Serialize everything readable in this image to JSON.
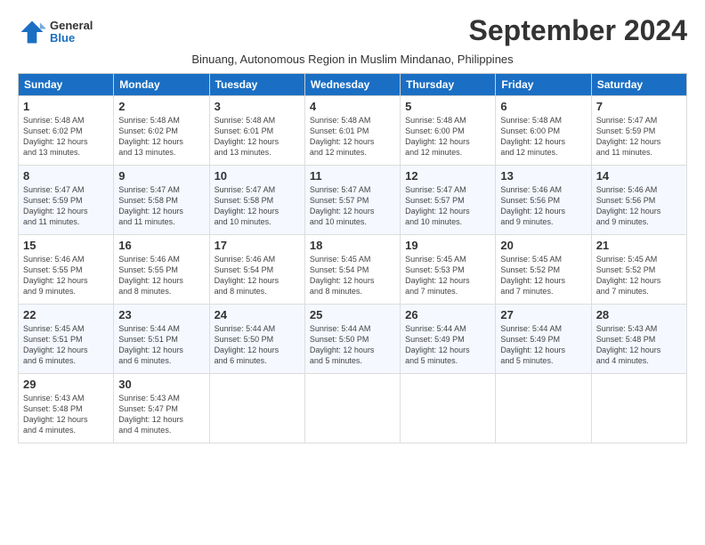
{
  "header": {
    "logo_general": "General",
    "logo_blue": "Blue",
    "month": "September 2024",
    "subtitle": "Binuang, Autonomous Region in Muslim Mindanao, Philippines"
  },
  "weekdays": [
    "Sunday",
    "Monday",
    "Tuesday",
    "Wednesday",
    "Thursday",
    "Friday",
    "Saturday"
  ],
  "weeks": [
    [
      {
        "day": "1",
        "lines": [
          "Sunrise: 5:48 AM",
          "Sunset: 6:02 PM",
          "Daylight: 12 hours",
          "and 13 minutes."
        ]
      },
      {
        "day": "2",
        "lines": [
          "Sunrise: 5:48 AM",
          "Sunset: 6:02 PM",
          "Daylight: 12 hours",
          "and 13 minutes."
        ]
      },
      {
        "day": "3",
        "lines": [
          "Sunrise: 5:48 AM",
          "Sunset: 6:01 PM",
          "Daylight: 12 hours",
          "and 13 minutes."
        ]
      },
      {
        "day": "4",
        "lines": [
          "Sunrise: 5:48 AM",
          "Sunset: 6:01 PM",
          "Daylight: 12 hours",
          "and 12 minutes."
        ]
      },
      {
        "day": "5",
        "lines": [
          "Sunrise: 5:48 AM",
          "Sunset: 6:00 PM",
          "Daylight: 12 hours",
          "and 12 minutes."
        ]
      },
      {
        "day": "6",
        "lines": [
          "Sunrise: 5:48 AM",
          "Sunset: 6:00 PM",
          "Daylight: 12 hours",
          "and 12 minutes."
        ]
      },
      {
        "day": "7",
        "lines": [
          "Sunrise: 5:47 AM",
          "Sunset: 5:59 PM",
          "Daylight: 12 hours",
          "and 11 minutes."
        ]
      }
    ],
    [
      {
        "day": "8",
        "lines": [
          "Sunrise: 5:47 AM",
          "Sunset: 5:59 PM",
          "Daylight: 12 hours",
          "and 11 minutes."
        ]
      },
      {
        "day": "9",
        "lines": [
          "Sunrise: 5:47 AM",
          "Sunset: 5:58 PM",
          "Daylight: 12 hours",
          "and 11 minutes."
        ]
      },
      {
        "day": "10",
        "lines": [
          "Sunrise: 5:47 AM",
          "Sunset: 5:58 PM",
          "Daylight: 12 hours",
          "and 10 minutes."
        ]
      },
      {
        "day": "11",
        "lines": [
          "Sunrise: 5:47 AM",
          "Sunset: 5:57 PM",
          "Daylight: 12 hours",
          "and 10 minutes."
        ]
      },
      {
        "day": "12",
        "lines": [
          "Sunrise: 5:47 AM",
          "Sunset: 5:57 PM",
          "Daylight: 12 hours",
          "and 10 minutes."
        ]
      },
      {
        "day": "13",
        "lines": [
          "Sunrise: 5:46 AM",
          "Sunset: 5:56 PM",
          "Daylight: 12 hours",
          "and 9 minutes."
        ]
      },
      {
        "day": "14",
        "lines": [
          "Sunrise: 5:46 AM",
          "Sunset: 5:56 PM",
          "Daylight: 12 hours",
          "and 9 minutes."
        ]
      }
    ],
    [
      {
        "day": "15",
        "lines": [
          "Sunrise: 5:46 AM",
          "Sunset: 5:55 PM",
          "Daylight: 12 hours",
          "and 9 minutes."
        ]
      },
      {
        "day": "16",
        "lines": [
          "Sunrise: 5:46 AM",
          "Sunset: 5:55 PM",
          "Daylight: 12 hours",
          "and 8 minutes."
        ]
      },
      {
        "day": "17",
        "lines": [
          "Sunrise: 5:46 AM",
          "Sunset: 5:54 PM",
          "Daylight: 12 hours",
          "and 8 minutes."
        ]
      },
      {
        "day": "18",
        "lines": [
          "Sunrise: 5:45 AM",
          "Sunset: 5:54 PM",
          "Daylight: 12 hours",
          "and 8 minutes."
        ]
      },
      {
        "day": "19",
        "lines": [
          "Sunrise: 5:45 AM",
          "Sunset: 5:53 PM",
          "Daylight: 12 hours",
          "and 7 minutes."
        ]
      },
      {
        "day": "20",
        "lines": [
          "Sunrise: 5:45 AM",
          "Sunset: 5:52 PM",
          "Daylight: 12 hours",
          "and 7 minutes."
        ]
      },
      {
        "day": "21",
        "lines": [
          "Sunrise: 5:45 AM",
          "Sunset: 5:52 PM",
          "Daylight: 12 hours",
          "and 7 minutes."
        ]
      }
    ],
    [
      {
        "day": "22",
        "lines": [
          "Sunrise: 5:45 AM",
          "Sunset: 5:51 PM",
          "Daylight: 12 hours",
          "and 6 minutes."
        ]
      },
      {
        "day": "23",
        "lines": [
          "Sunrise: 5:44 AM",
          "Sunset: 5:51 PM",
          "Daylight: 12 hours",
          "and 6 minutes."
        ]
      },
      {
        "day": "24",
        "lines": [
          "Sunrise: 5:44 AM",
          "Sunset: 5:50 PM",
          "Daylight: 12 hours",
          "and 6 minutes."
        ]
      },
      {
        "day": "25",
        "lines": [
          "Sunrise: 5:44 AM",
          "Sunset: 5:50 PM",
          "Daylight: 12 hours",
          "and 5 minutes."
        ]
      },
      {
        "day": "26",
        "lines": [
          "Sunrise: 5:44 AM",
          "Sunset: 5:49 PM",
          "Daylight: 12 hours",
          "and 5 minutes."
        ]
      },
      {
        "day": "27",
        "lines": [
          "Sunrise: 5:44 AM",
          "Sunset: 5:49 PM",
          "Daylight: 12 hours",
          "and 5 minutes."
        ]
      },
      {
        "day": "28",
        "lines": [
          "Sunrise: 5:43 AM",
          "Sunset: 5:48 PM",
          "Daylight: 12 hours",
          "and 4 minutes."
        ]
      }
    ],
    [
      {
        "day": "29",
        "lines": [
          "Sunrise: 5:43 AM",
          "Sunset: 5:48 PM",
          "Daylight: 12 hours",
          "and 4 minutes."
        ]
      },
      {
        "day": "30",
        "lines": [
          "Sunrise: 5:43 AM",
          "Sunset: 5:47 PM",
          "Daylight: 12 hours",
          "and 4 minutes."
        ]
      },
      {
        "day": "",
        "lines": []
      },
      {
        "day": "",
        "lines": []
      },
      {
        "day": "",
        "lines": []
      },
      {
        "day": "",
        "lines": []
      },
      {
        "day": "",
        "lines": []
      }
    ]
  ]
}
